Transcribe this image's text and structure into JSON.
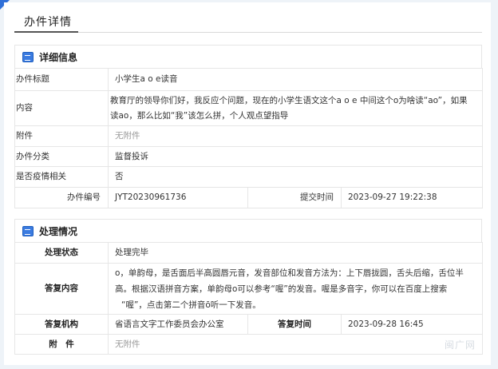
{
  "page": {
    "title": "办件详情"
  },
  "detail": {
    "section_title": "详细信息",
    "rows": [
      {
        "label": "办件标题",
        "value": "小学生a o e读音"
      },
      {
        "label": "内容",
        "value_line1": "教育厅的领导你们好，我反应个问题，现在的小学生语文这个a o e 中间这个o为啥读“ao”，如果",
        "value_line2": "读ao，那么比如“我”该怎么拼，个人观点望指导"
      },
      {
        "label": "附件",
        "value": "无附件"
      },
      {
        "label": "办件分类",
        "value": "监督投诉"
      },
      {
        "label": "是否疫情相关",
        "value": "否"
      }
    ],
    "number_label": "办件编号",
    "number_value": "JYT20230961736",
    "submit_label": "提交时间",
    "submit_value": "2023-09-27 19:22:38"
  },
  "handling": {
    "section_title": "处理情况",
    "status_label": "处理状态",
    "status_value": "处理完毕",
    "reply_label": "答复内容",
    "reply_line1": "o，单韵母，是舌面后半高圆唇元音，发音部位和发音方法为：上下唇拢圆，舌头后缩，舌位半",
    "reply_line2": "高。根据汉语拼音方案，单韵母o可以参考“喔”的发音。喔是多音字，你可以在百度上搜索",
    "reply_line3": "“喔”，点击第二个拼音ō听一下发音。",
    "org_label": "答复机构",
    "org_value": "省语言文字工作委员会办公室",
    "time_label": "答复时间",
    "time_value": "2023-09-28 16:45",
    "attach_label": "附　件",
    "attach_value": "无附件"
  },
  "watermark": "闽广网",
  "colors": {
    "accent": "#2f6fd8",
    "border": "#e6e6e6",
    "background": "#eef3f8"
  }
}
